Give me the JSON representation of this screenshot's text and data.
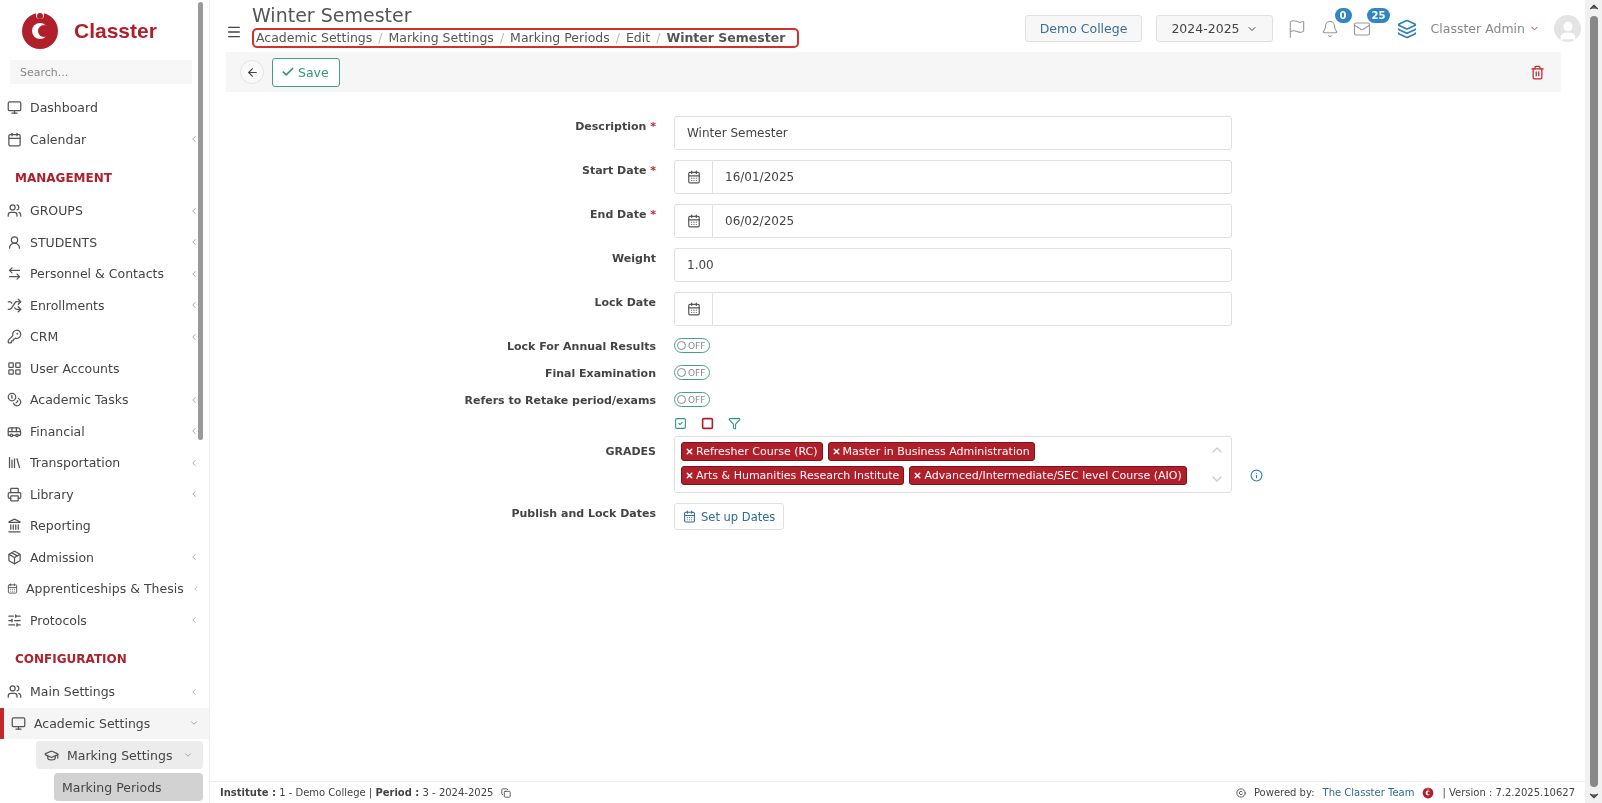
{
  "brand": {
    "name": "Classter"
  },
  "sidebar": {
    "search": {
      "placeholder": "Search..."
    },
    "sections": [
      {
        "items": [
          {
            "label": "Dashboard",
            "expandable": false,
            "expanded": false,
            "selected": false
          },
          {
            "label": "Calendar",
            "expandable": true,
            "expanded": false,
            "selected": false
          }
        ]
      },
      {
        "heading": "MANAGEMENT",
        "items": [
          {
            "label": "GROUPS",
            "expandable": true,
            "expanded": false,
            "selected": false
          },
          {
            "label": "STUDENTS",
            "expandable": true,
            "expanded": false,
            "selected": false
          },
          {
            "label": "Personnel & Contacts",
            "expandable": true,
            "expanded": false,
            "selected": false
          },
          {
            "label": "Enrollments",
            "expandable": true,
            "expanded": false,
            "selected": false
          },
          {
            "label": "CRM",
            "expandable": true,
            "expanded": false,
            "selected": false
          },
          {
            "label": "User Accounts",
            "expandable": false,
            "expanded": false,
            "selected": false
          },
          {
            "label": "Academic Tasks",
            "expandable": true,
            "expanded": false,
            "selected": false
          },
          {
            "label": "Financial",
            "expandable": true,
            "expanded": false,
            "selected": false
          },
          {
            "label": "Transportation",
            "expandable": true,
            "expanded": false,
            "selected": false
          },
          {
            "label": "Library",
            "expandable": true,
            "expanded": false,
            "selected": false
          },
          {
            "label": "Reporting",
            "expandable": false,
            "expanded": false,
            "selected": false
          },
          {
            "label": "Admission",
            "expandable": true,
            "expanded": false,
            "selected": false
          },
          {
            "label": "Apprenticeships & Thesis",
            "expandable": true,
            "expanded": false,
            "selected": false
          },
          {
            "label": "Protocols",
            "expandable": true,
            "expanded": false,
            "selected": false
          }
        ]
      },
      {
        "heading": "CONFIGURATION",
        "items": [
          {
            "label": "Main Settings",
            "expandable": true,
            "expanded": false,
            "selected": false
          },
          {
            "label": "Academic Settings",
            "expandable": true,
            "expanded": true,
            "selected": false,
            "children": [
              {
                "label": "Marking Settings",
                "expandable": true,
                "expanded": true,
                "selected": false,
                "children": [
                  {
                    "label": "Marking Periods",
                    "expandable": false,
                    "expanded": false,
                    "selected": true
                  }
                ]
              }
            ]
          }
        ]
      }
    ]
  },
  "header": {
    "title": "Winter Semester",
    "separator": "/",
    "breadcrumb": [
      "Academic Settings",
      "Marking Settings",
      "Marking Periods",
      "Edit",
      "Winter Semester"
    ],
    "institution": "Demo College",
    "year": "2024-2025",
    "notifications": "0",
    "messages": "25",
    "user": "Classter Admin"
  },
  "toolbar": {
    "save": "Save"
  },
  "form": {
    "required_mark": "*",
    "fields": [
      {
        "kind": "text",
        "label": "Description",
        "required": true,
        "value": "Winter Semester"
      },
      {
        "kind": "date",
        "label": "Start Date",
        "required": true,
        "value": "16/01/2025"
      },
      {
        "kind": "date",
        "label": "End Date",
        "required": true,
        "value": "06/02/2025"
      },
      {
        "kind": "text",
        "label": "Weight",
        "required": false,
        "value": "1.00"
      },
      {
        "kind": "date",
        "label": "Lock Date",
        "required": false
      },
      {
        "kind": "toggle",
        "label": "Lock For Annual Results",
        "required": false,
        "on": false,
        "state_label": "OFF"
      },
      {
        "kind": "toggle",
        "label": "Final Examination",
        "required": false,
        "on": false,
        "state_label": "OFF"
      },
      {
        "kind": "toggle",
        "label": "Refers to Retake period/exams",
        "required": false,
        "on": false,
        "state_label": "OFF"
      },
      {
        "kind": "tags",
        "label": "GRADES",
        "required": false,
        "tags": [
          "Refresher Course (RC)",
          "Master in Business Administration",
          "Arts & Humanities Research Institute",
          "Advanced/Intermediate/SEC level Course (AIO)"
        ]
      },
      {
        "kind": "button",
        "label": "Publish and Lock Dates",
        "required": false,
        "button": "Set up Dates"
      }
    ]
  },
  "footer": {
    "info": "**Institute :** 1 - Demo College | **Period :** 3 - 2024-2025",
    "powered": "Powered by:",
    "team": "The Classter Team",
    "version": "| Version : 7.2.2025.10627"
  }
}
